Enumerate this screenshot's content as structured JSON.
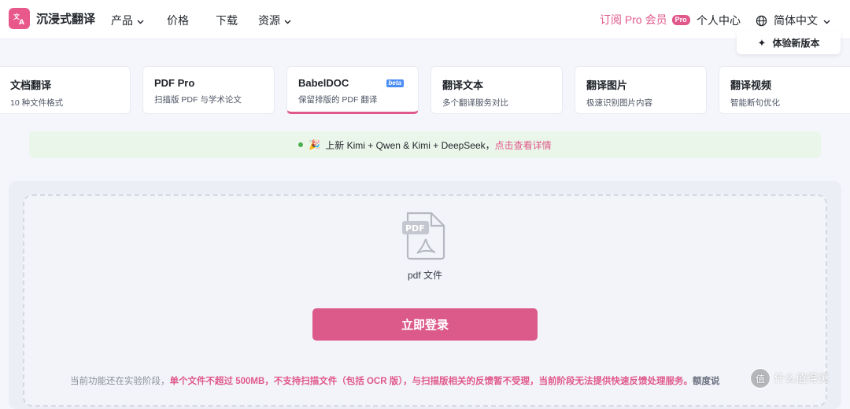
{
  "header": {
    "logo_text": "沉浸式翻译",
    "nav": [
      {
        "label": "产品",
        "has_dropdown": true
      },
      {
        "label": "价格",
        "has_dropdown": false
      },
      {
        "label": "下载",
        "has_dropdown": false
      },
      {
        "label": "资源",
        "has_dropdown": true
      }
    ],
    "subscribe_label": "订阅 Pro 会员",
    "pro_badge": "Pro",
    "account_label": "个人中心",
    "language_label": "简体中文",
    "try_new_label": "体验新版本"
  },
  "cards": [
    {
      "title": "文档翻译",
      "subtitle": "10 种文件格式",
      "active": false
    },
    {
      "title": "PDF Pro",
      "subtitle": "扫描版 PDF 与学术论文",
      "active": false
    },
    {
      "title": "BabelDOC",
      "subtitle": "保留排版的 PDF 翻译",
      "badge": "beta",
      "active": true
    },
    {
      "title": "翻译文本",
      "subtitle": "多个翻译服务对比",
      "active": false
    },
    {
      "title": "翻译图片",
      "subtitle": "极速识别图片内容",
      "active": false
    },
    {
      "title": "翻译视频",
      "subtitle": "智能断句优化",
      "active": false
    }
  ],
  "announcement": {
    "text": "上新 Kimi + Qwen & Kimi + DeepSeek，",
    "link_text": "点击查看详情"
  },
  "upload": {
    "file_icon_text": "PDF",
    "file_label": "pdf 文件",
    "login_button": "立即登录"
  },
  "notice": {
    "lead": "当前功能还在实验阶段，",
    "emphasis": "单个文件不超过 500MB，不支持扫描文件（包括 OCR 版），与扫描版相关的反馈暂不受理，当前阶段无法提供快速反馈处理服务。",
    "tail": "额度说"
  },
  "watermark": {
    "text": "什么值得买",
    "circle": "值"
  },
  "colors": {
    "accent": "#e0588a",
    "button": "#dc5a89",
    "announce_bg": "#eaf6ea",
    "beta_badge": "#4b8ef5"
  }
}
